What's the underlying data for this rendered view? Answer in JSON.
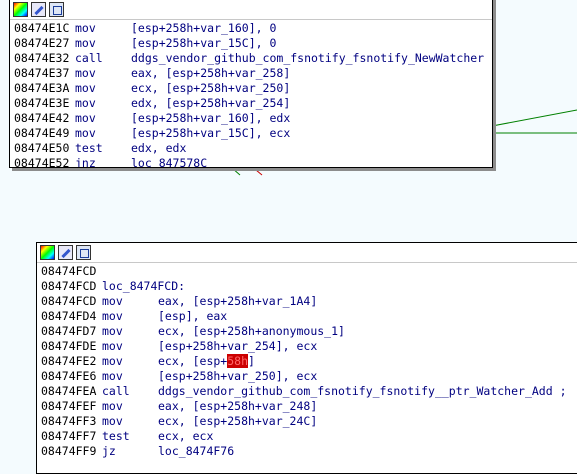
{
  "colors": {
    "background": "#f4fbfe",
    "address": "#000000",
    "mnemonic": "#000080",
    "number": "#008000",
    "highlight": "#cc0000",
    "edge_true": "#008000",
    "edge_false": "#cc0000",
    "edge_loop": "#0000cc"
  },
  "node1": {
    "icons": [
      "color-picker-icon",
      "edit-node-icon",
      "graph-overview-icon"
    ],
    "lines": [
      {
        "addr": "08474E1C",
        "mn": "mov",
        "op": "[esp+258h+var_160], 0"
      },
      {
        "addr": "08474E27",
        "mn": "mov",
        "op": "[esp+258h+var_15C], 0"
      },
      {
        "addr": "08474E32",
        "mn": "call",
        "op": "ddgs_vendor_github_com_fsnotify_fsnotify_NewWatcher"
      },
      {
        "addr": "08474E37",
        "mn": "mov",
        "op": "eax, [esp+258h+var_258]"
      },
      {
        "addr": "08474E3A",
        "mn": "mov",
        "op": "ecx, [esp+258h+var_250]"
      },
      {
        "addr": "08474E3E",
        "mn": "mov",
        "op": "edx, [esp+258h+var_254]"
      },
      {
        "addr": "08474E42",
        "mn": "mov",
        "op": "[esp+258h+var_160], edx"
      },
      {
        "addr": "08474E49",
        "mn": "mov",
        "op": "[esp+258h+var_15C], ecx"
      },
      {
        "addr": "08474E50",
        "mn": "test",
        "op": "edx, edx"
      },
      {
        "addr": "08474E52",
        "mn": "jnz",
        "op": "loc_847578C"
      }
    ]
  },
  "node2": {
    "icons": [
      "color-picker-icon",
      "edit-node-icon",
      "graph-overview-icon"
    ],
    "lines": [
      {
        "addr": "08474FCD",
        "mn": "",
        "op": ""
      },
      {
        "addr": "08474FCD",
        "mn": "loc_8474FCD:",
        "op": ""
      },
      {
        "addr": "08474FCD",
        "mn": "mov",
        "op": "eax, [esp+258h+var_1A4]"
      },
      {
        "addr": "08474FD4",
        "mn": "mov",
        "op": "[esp], eax"
      },
      {
        "addr": "08474FD7",
        "mn": "mov",
        "op": "ecx, [esp+258h+anonymous_1]"
      },
      {
        "addr": "08474FDE",
        "mn": "mov",
        "op": "[esp+258h+var_254], ecx"
      },
      {
        "addr": "08474FE2",
        "mn": "mov",
        "op_pre": "ecx, [esp+",
        "op_hl": "58h",
        "op_post": "]"
      },
      {
        "addr": "08474FE6",
        "mn": "mov",
        "op": "[esp+258h+var_250], ecx"
      },
      {
        "addr": "08474FEA",
        "mn": "call",
        "op": "ddgs_vendor_github_com_fsnotify_fsnotify__ptr_Watcher_Add ;"
      },
      {
        "addr": "08474FEF",
        "mn": "mov",
        "op": "eax, [esp+258h+var_248]"
      },
      {
        "addr": "08474FF3",
        "mn": "mov",
        "op": "ecx, [esp+258h+var_24C]"
      },
      {
        "addr": "08474FF7",
        "mn": "test",
        "op": "ecx, ecx"
      },
      {
        "addr": "08474FF9",
        "mn": "jz",
        "op": "loc_8474F76"
      }
    ]
  }
}
